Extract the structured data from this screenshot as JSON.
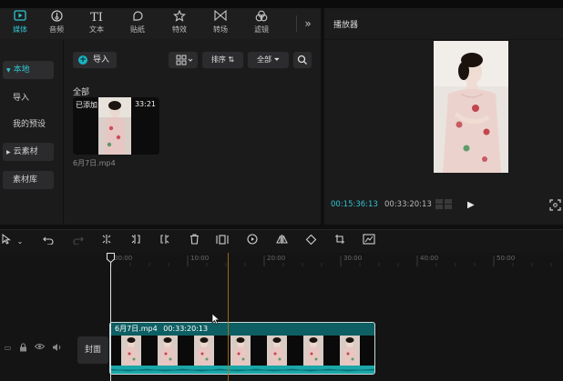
{
  "tabs": [
    {
      "label": "媒体",
      "icon": "media-icon",
      "active": true
    },
    {
      "label": "音频",
      "icon": "audio-icon"
    },
    {
      "label": "文本",
      "icon": "text-icon"
    },
    {
      "label": "贴纸",
      "icon": "sticker-icon"
    },
    {
      "label": "特效",
      "icon": "effects-icon"
    },
    {
      "label": "转场",
      "icon": "transition-icon"
    },
    {
      "label": "滤镜",
      "icon": "filter-icon"
    }
  ],
  "more_label": "»",
  "sidebar": {
    "local": "本地",
    "import": "导入",
    "presets": "我的预设",
    "cloud": "云素材",
    "library": "素材库"
  },
  "toolbar": {
    "import_label": "导入",
    "sort_label": "排序",
    "filter_label": "全部"
  },
  "section_label": "全部",
  "media_item": {
    "status": "已添加",
    "duration": "33:21",
    "filename": "6月7日.mp4"
  },
  "player": {
    "title": "播放器",
    "current_time": "00:15:36:13",
    "total_time": "00:33:20:13"
  },
  "ruler_labels": [
    "00:00",
    "10:00",
    "20:00",
    "30:00",
    "40:00",
    "50:00"
  ],
  "timeline": {
    "cover_label": "封面",
    "clip_name": "6月7日.mp4",
    "clip_duration": "00:33:20:13"
  },
  "colors": {
    "accent": "#2fc3cf",
    "clip": "#0e5f63",
    "audio_wave": "#1aa7a9",
    "marker": "#b77416"
  }
}
